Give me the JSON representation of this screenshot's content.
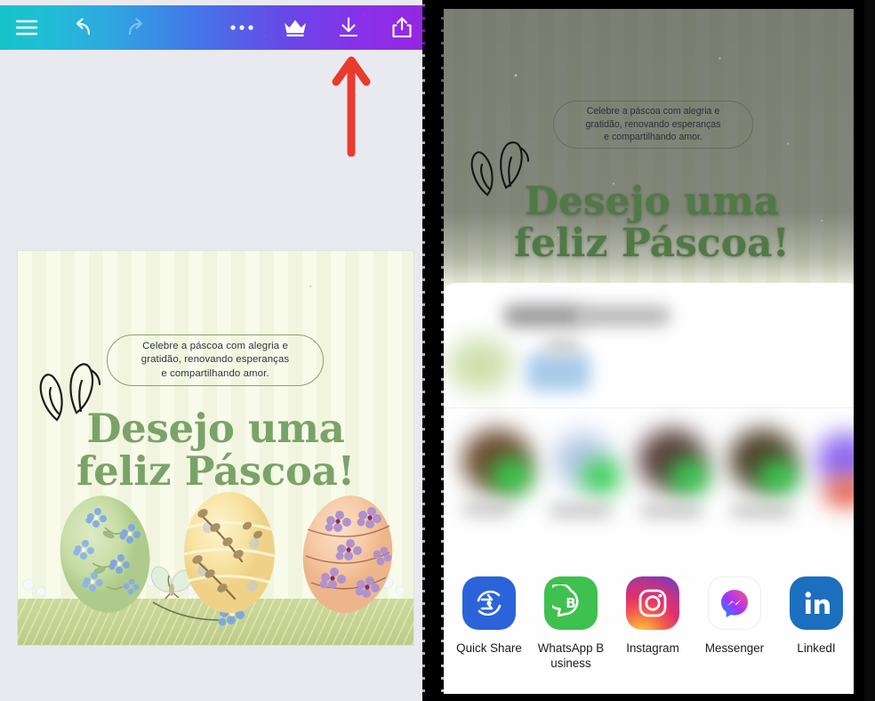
{
  "editor": {
    "toolbar": {
      "menu_label": "Menu",
      "undo_label": "Undo",
      "redo_label": "Redo",
      "more_label": "More options",
      "premium_label": "Premium",
      "download_label": "Download",
      "share_label": "Share",
      "gradient_start": "#17c3c8",
      "gradient_end": "#9726e0"
    },
    "annotation": {
      "type": "arrow",
      "points_to": "download-button",
      "color": "#e83b30"
    },
    "canvas_background": "#e9eaf0"
  },
  "design": {
    "background_color": "#f6f8e8",
    "stripe_color": "#f1f5df",
    "message": {
      "lines": [
        "Celebre a páscoa com alegria e",
        "gratidão, renovando esperanças",
        "e compartilhando amor."
      ],
      "border_color": "#8d9c78",
      "text_color": "#2e3440"
    },
    "headline": {
      "line1": "Desejo uma",
      "line2": "feliz Páscoa!",
      "color": "#7aa368"
    },
    "illustration": {
      "bunny_ears": "bunny-ears-line-art",
      "grass_color": "#c4d28f",
      "eggs": [
        {
          "name": "green-egg-forget-me-not",
          "shell": "#c5d9a6",
          "flower": "#7ea6e0"
        },
        {
          "name": "yellow-egg-pussy-willow",
          "shell": "#f7e3a0",
          "flower": "#b9a177"
        },
        {
          "name": "peach-egg-violets",
          "shell": "#f6c9a4",
          "flower": "#a98ac9"
        }
      ],
      "butterfly": "butterfly-pale-green"
    }
  },
  "share_sheet": {
    "preview_overlay": "dark-scrim",
    "apps": [
      {
        "name": "quick-share",
        "label": "Quick Share",
        "color": "#2b63d9"
      },
      {
        "name": "whatsapp-business",
        "label": "WhatsApp B\nusiness",
        "color": "#3fc14f"
      },
      {
        "name": "instagram",
        "label": "Instagram",
        "color": "#e1306c"
      },
      {
        "name": "messenger",
        "label": "Messenger",
        "color": "#a334fa"
      },
      {
        "name": "linkedin",
        "label": "LinkedI",
        "color": "#1c6fbf"
      }
    ],
    "blurred_rows_note": "blurred"
  }
}
